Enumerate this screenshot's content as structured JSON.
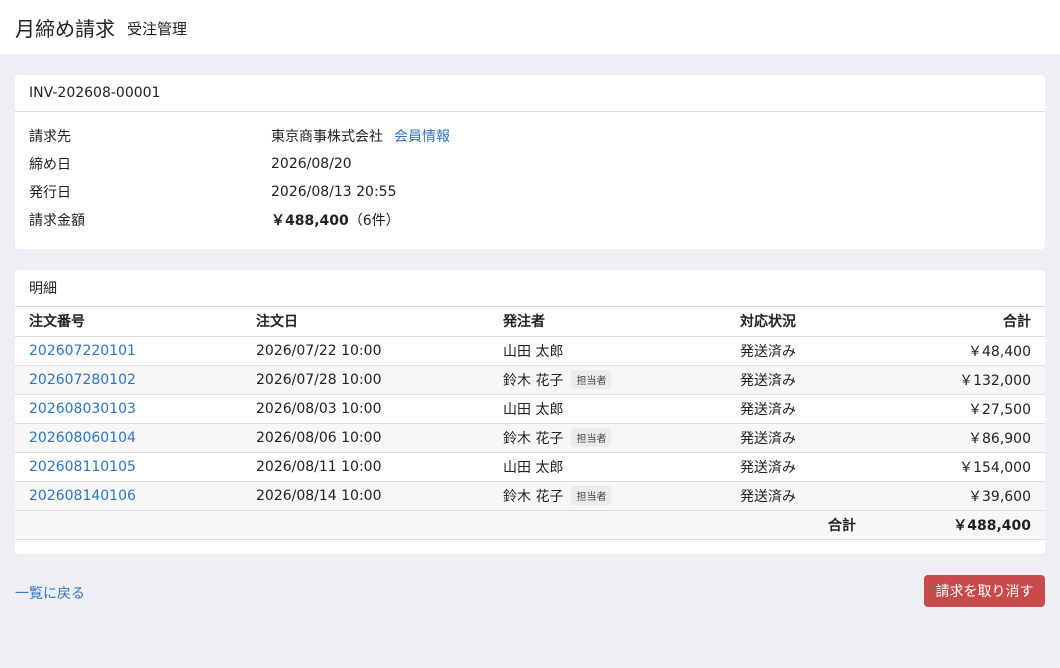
{
  "header": {
    "title": "月締め請求",
    "subtitle": "受注管理"
  },
  "invoice": {
    "number": "INV-202608-00001",
    "fields": {
      "billing_to_label": "請求先",
      "billing_to_value": "東京商事株式会社",
      "member_info_link": "会員情報",
      "closing_date_label": "締め日",
      "closing_date_value": "2026/08/20",
      "issue_date_label": "発行日",
      "issue_date_value": "2026/08/13 20:55",
      "amount_label": "請求金額",
      "amount_value": "￥488,400",
      "amount_count": "（6件）"
    }
  },
  "items": {
    "section_title": "明細",
    "columns": [
      "注文番号",
      "注文日",
      "発注者",
      "対応状況",
      "合計"
    ],
    "rows": [
      {
        "order_no": "202607220101",
        "date": "2026/07/22 10:00",
        "orderer": "山田 太郎",
        "badge": "",
        "status": "発送済み",
        "total": "￥48,400"
      },
      {
        "order_no": "202607280102",
        "date": "2026/07/28 10:00",
        "orderer": "鈴木 花子",
        "badge": "担当者",
        "status": "発送済み",
        "total": "￥132,000"
      },
      {
        "order_no": "202608030103",
        "date": "2026/08/03 10:00",
        "orderer": "山田 太郎",
        "badge": "",
        "status": "発送済み",
        "total": "￥27,500"
      },
      {
        "order_no": "202608060104",
        "date": "2026/08/06 10:00",
        "orderer": "鈴木 花子",
        "badge": "担当者",
        "status": "発送済み",
        "total": "￥86,900"
      },
      {
        "order_no": "202608110105",
        "date": "2026/08/11 10:00",
        "orderer": "山田 太郎",
        "badge": "",
        "status": "発送済み",
        "total": "￥154,000"
      },
      {
        "order_no": "202608140106",
        "date": "2026/08/14 10:00",
        "orderer": "鈴木 花子",
        "badge": "担当者",
        "status": "発送済み",
        "total": "￥39,600"
      }
    ],
    "footer_label": "合計",
    "footer_total": "￥488,400"
  },
  "actions": {
    "back_label": "一覧に戻る",
    "cancel_label": "請求を取り消す"
  },
  "colors": {
    "link": "#2f74c0",
    "danger": "#c94a4a",
    "background": "#eeeff2"
  }
}
